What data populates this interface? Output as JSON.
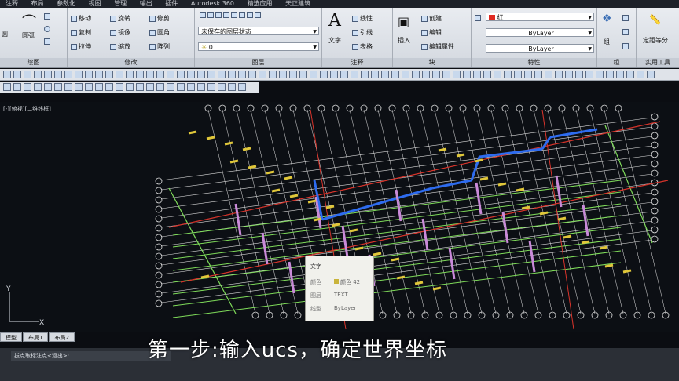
{
  "menubar": [
    "注释",
    "布局",
    "参数化",
    "视图",
    "管理",
    "输出",
    "插件",
    "Autodesk 360",
    "精选应用",
    "天正建筑"
  ],
  "ribbon": {
    "draw_panel": {
      "line_label": "圆",
      "arc_label": "圆弧",
      "title": "绘图"
    },
    "modify_panel": {
      "move": "移动",
      "rotate": "旋转",
      "trim": "修剪",
      "copy": "复制",
      "mirror": "镜像",
      "fillet": "圆角",
      "stretch": "拉伸",
      "scale": "缩放",
      "array": "阵列",
      "title": "修改"
    },
    "layer_panel": {
      "layer_state": "未保存的图层状态",
      "layer_current": "0",
      "title": "图层"
    },
    "annotation_panel": {
      "text": "文字",
      "linear": "线性",
      "leader": "引线",
      "table": "表格",
      "title": "注释"
    },
    "block_panel": {
      "insert": "插入",
      "create": "创建",
      "edit": "编辑",
      "edit_attr": "编辑属性",
      "title": "块"
    },
    "properties_panel": {
      "color": "红",
      "linetype": "ByLayer",
      "lineweight": "ByLayer",
      "title": "特性"
    },
    "group_panel": {
      "group": "组",
      "title": "组"
    },
    "utilities_panel": {
      "measure": "定距等分",
      "title": "实用工具"
    }
  },
  "viewport_label": "[-][俯视][二维线框]",
  "tooltip": {
    "title": "文字",
    "rows": [
      {
        "key": "颜色",
        "value": "颜色 42"
      },
      {
        "key": "图层",
        "value": "TEXT"
      },
      {
        "key": "线型",
        "value": "ByLayer"
      }
    ]
  },
  "layout_tabs": [
    "模型",
    "布局1",
    "布局2"
  ],
  "command_prompt": "拔点取标注点<退出>:",
  "subtitle": "第一步:输入ucs，确定世界坐标",
  "ucs": {
    "x_label": "X",
    "y_label": "Y"
  },
  "colors": {
    "ribbon_bg": "#e1e5ea",
    "canvas_bg": "#0c0f14",
    "grid_green": "#7fdc5a",
    "axis_red": "#d8342b",
    "wall_blue": "#2e6cf0"
  }
}
